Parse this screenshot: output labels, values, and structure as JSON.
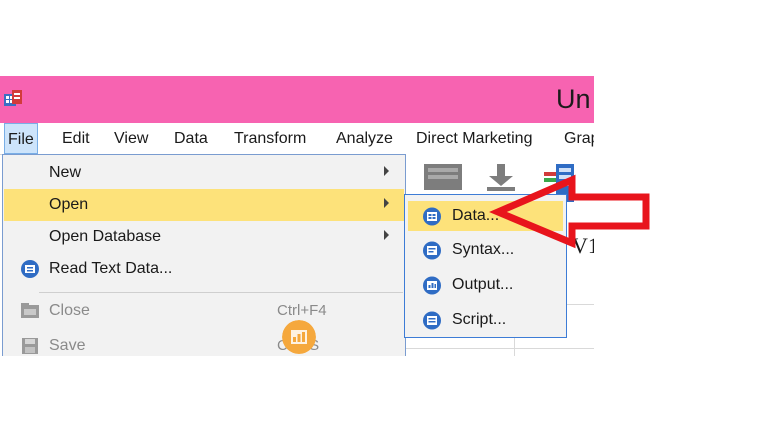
{
  "window": {
    "title": "Un"
  },
  "menubar": {
    "items": [
      {
        "label": "File",
        "active": true
      },
      {
        "label": "Edit"
      },
      {
        "label": "View"
      },
      {
        "label": "Data"
      },
      {
        "label": "Transform"
      },
      {
        "label": "Analyze"
      },
      {
        "label": "Direct Marketing"
      },
      {
        "label": "Grap"
      }
    ]
  },
  "file_menu": {
    "items": [
      {
        "label": "New",
        "submenu": true
      },
      {
        "label": "Open",
        "submenu": true,
        "highlighted": true
      },
      {
        "label": "Open Database",
        "submenu": true
      },
      {
        "label": "Read Text Data...",
        "icon": "read-text-data-icon"
      },
      {
        "label": "Close",
        "shortcut": "Ctrl+F4",
        "disabled": true,
        "icon": "close-folder-icon"
      },
      {
        "label": "Save",
        "shortcut": "Ctrl+S",
        "disabled": true,
        "icon": "save-icon"
      }
    ]
  },
  "open_submenu": {
    "items": [
      {
        "label": "Data...",
        "highlighted": true,
        "icon": "data-file-icon"
      },
      {
        "label": "Syntax...",
        "icon": "syntax-file-icon"
      },
      {
        "label": "Output...",
        "icon": "output-file-icon"
      },
      {
        "label": "Script...",
        "icon": "script-file-icon"
      }
    ]
  },
  "grid": {
    "column_header": "V1"
  },
  "colors": {
    "titlebar": "#f763b1",
    "menu_highlight": "#fde27a",
    "active_menu": "#cde4fb",
    "annotation_arrow": "#e8141c"
  }
}
